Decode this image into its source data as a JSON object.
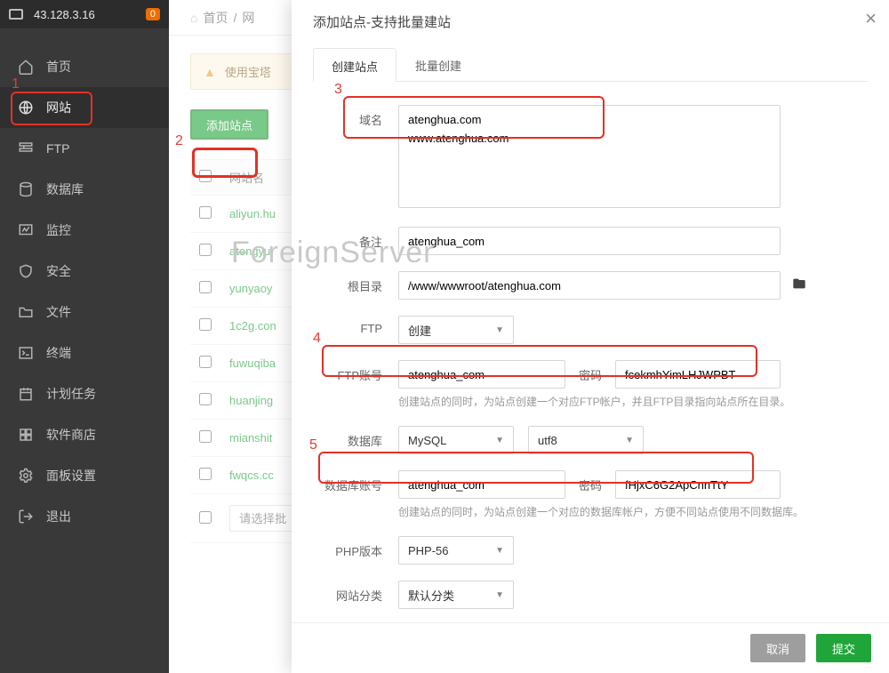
{
  "top": {
    "ip": "43.128.3.16",
    "badge": "0"
  },
  "sidebar": {
    "items": [
      {
        "label": "首页"
      },
      {
        "label": "网站"
      },
      {
        "label": "FTP"
      },
      {
        "label": "数据库"
      },
      {
        "label": "监控"
      },
      {
        "label": "安全"
      },
      {
        "label": "文件"
      },
      {
        "label": "终端"
      },
      {
        "label": "计划任务"
      },
      {
        "label": "软件商店"
      },
      {
        "label": "面板设置"
      },
      {
        "label": "退出"
      }
    ]
  },
  "breadcrumb": {
    "home": "首页",
    "sep": "/",
    "current": "网"
  },
  "warn": {
    "text": "使用宝塔"
  },
  "toolbar": {
    "add_site": "添加站点"
  },
  "table": {
    "header": {
      "name": "网站名"
    },
    "rows": [
      {
        "name": "aliyun.hu"
      },
      {
        "name": "atengyur"
      },
      {
        "name": "yunyaoy"
      },
      {
        "name": "1c2g.con"
      },
      {
        "name": "fuwuqiba"
      },
      {
        "name": "huanjing"
      },
      {
        "name": "mianshit"
      },
      {
        "name": "fwqcs.cc"
      }
    ],
    "select_placeholder": "请选择批"
  },
  "modal": {
    "title": "添加站点-支持批量建站",
    "tabs": {
      "create": "创建站点",
      "batch": "批量创建"
    },
    "labels": {
      "domain": "域名",
      "note": "备注",
      "root": "根目录",
      "ftp": "FTP",
      "ftp_user": "FTP账号",
      "pwd": "密码",
      "db": "数据库",
      "db_user": "数据库账号",
      "php": "PHP版本",
      "cat": "网站分类"
    },
    "values": {
      "domain_text": "atenghua.com\nwww.atenghua.com",
      "note": "atenghua_com",
      "root": "/www/wwwroot/atenghua.com",
      "ftp_sel": "创建",
      "ftp_user": "atenghua_com",
      "ftp_pwd": "fcekmhYimLHJWPBT",
      "db_sel": "MySQL",
      "db_charset": "utf8",
      "db_user": "atenghua_com",
      "db_pwd": "fHjxC6G2ApCnnTtY",
      "php_sel": "PHP-56",
      "cat_sel": "默认分类"
    },
    "help": {
      "ftp": "创建站点的同时，为站点创建一个对应FTP帐户，并且FTP目录指向站点所在目录。",
      "db": "创建站点的同时，为站点创建一个对应的数据库帐户，方便不同站点使用不同数据库。"
    },
    "footer": {
      "cancel": "取消",
      "submit": "提交"
    }
  },
  "annotations": {
    "n1": "1",
    "n2": "2",
    "n3": "3",
    "n4": "4",
    "n5": "5"
  },
  "watermark": "ForeignServer"
}
